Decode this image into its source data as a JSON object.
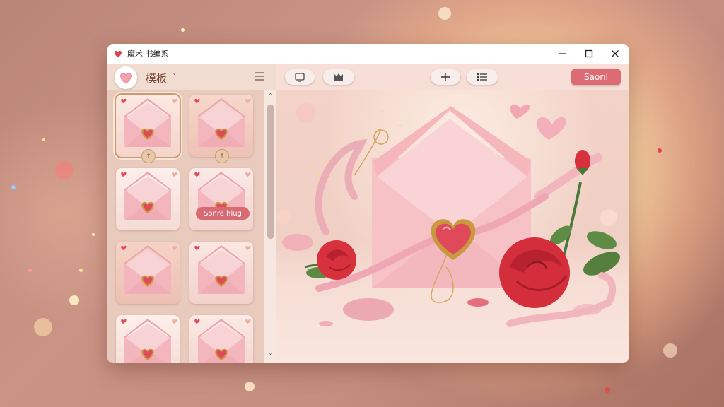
{
  "window": {
    "title": "魔术 书编系",
    "icon": "heart-icon",
    "controls": [
      "minimize-icon",
      "maximize-icon",
      "close-icon"
    ]
  },
  "sidebar": {
    "header_label": "模板",
    "header_chevron": "˅",
    "cards": [
      {
        "badge": "†",
        "button": ""
      },
      {
        "badge": "†",
        "button": ""
      },
      {
        "badge": "",
        "button": ""
      },
      {
        "badge": "",
        "button": "Sonre hlug"
      },
      {
        "badge": "",
        "button": ""
      },
      {
        "badge": "",
        "button": ""
      },
      {
        "badge": "",
        "button": ""
      },
      {
        "badge": "",
        "button": ""
      }
    ]
  },
  "toolbar": {
    "buttons": [
      "frame-icon",
      "crown-icon",
      "add-icon",
      "list-icon"
    ],
    "save_label": "Saorıl"
  },
  "colors": {
    "accent": "#dc6b73",
    "envelope": "#f4b9bd",
    "rose": "#d8313e",
    "gold": "#c9983f"
  }
}
